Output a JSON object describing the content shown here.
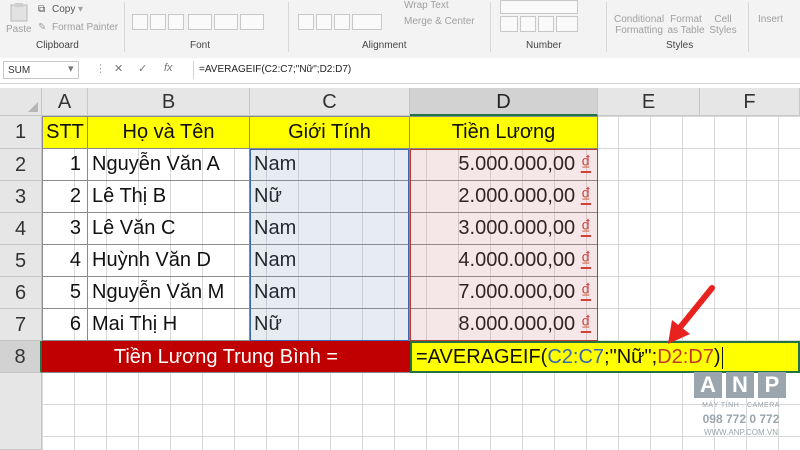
{
  "ribbon": {
    "clipboard": {
      "paste": "Paste",
      "copy": "Copy",
      "format_painter": "Format Painter",
      "label": "Clipboard"
    },
    "font": {
      "label": "Font"
    },
    "alignment": {
      "merge_center": "Merge & Center",
      "wrap_text": "Wrap Text",
      "label": "Alignment"
    },
    "number": {
      "label": "Number"
    },
    "styles": {
      "conditional_formatting": "Conditional Formatting",
      "format_as_table": "Format as Table",
      "cell_styles": "Cell Styles",
      "label": "Styles"
    },
    "cells": {
      "insert": "Insert"
    }
  },
  "formula_bar": {
    "name_box": "SUM",
    "fx": "fx",
    "formula": "=AVERAGEIF(C2:C7;\"Nữ\";D2:D7)"
  },
  "columns": [
    "A",
    "B",
    "C",
    "D",
    "E",
    "F"
  ],
  "rows": [
    "1",
    "2",
    "3",
    "4",
    "5",
    "6",
    "7",
    "8"
  ],
  "table": {
    "headers": [
      "STT",
      "Họ và Tên",
      "Giới Tính",
      "Tiền Lương"
    ],
    "records": [
      {
        "stt": "1",
        "name": "Nguyễn Văn A",
        "gender": "Nam",
        "salary": "5.000.000,00",
        "currency": "₫"
      },
      {
        "stt": "2",
        "name": "Lê Thị B",
        "gender": "Nữ",
        "salary": "2.000.000,00",
        "currency": "₫"
      },
      {
        "stt": "3",
        "name": "Lê Văn C",
        "gender": "Nam",
        "salary": "3.000.000,00",
        "currency": "₫"
      },
      {
        "stt": "4",
        "name": "Huỳnh Văn D",
        "gender": "Nam",
        "salary": "4.000.000,00",
        "currency": "₫"
      },
      {
        "stt": "5",
        "name": "Nguyễn Văn M",
        "gender": "Nam",
        "salary": "7.000.000,00",
        "currency": "₫"
      },
      {
        "stt": "6",
        "name": "Mai Thị H",
        "gender": "Nữ",
        "salary": "8.000.000,00",
        "currency": "₫"
      }
    ],
    "total_label": "Tiền Lương Trung Bình =",
    "edit_formula": {
      "prefix": "=AVERAGEIF(",
      "range1": "C2:C7",
      "sep1": ";\"Nữ\";",
      "range2": "D2:D7",
      "suffix": ")"
    }
  },
  "watermark": {
    "letters": [
      "A",
      "N",
      "P"
    ],
    "line1": "MÁY TÍNH · CAMERA",
    "phone": "098 772 0 772",
    "site": "WWW.ANP.COM.VN"
  },
  "colors": {
    "header_fill": "#ffff00",
    "total_fill": "#c00000",
    "range1": "#3c68b0",
    "range2": "#c0392b",
    "arrow": "#e8231f"
  }
}
